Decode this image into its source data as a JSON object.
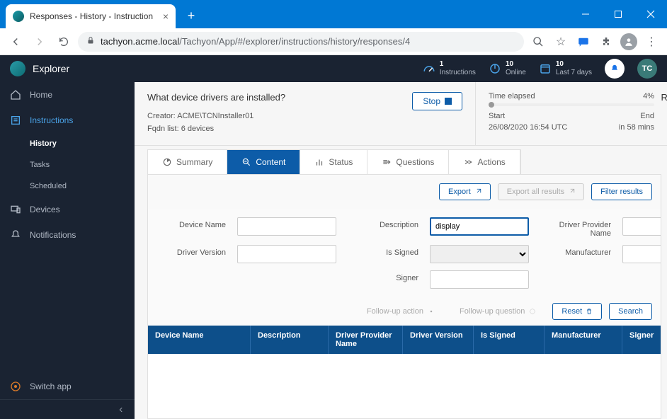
{
  "browser": {
    "tab_title": "Responses - History - Instruction",
    "url_host": "tachyon.acme.local",
    "url_path": "/Tachyon/App/#/explorer/instructions/history/responses/4"
  },
  "app_header": {
    "title": "Explorer",
    "status": [
      {
        "num": "1",
        "lbl": "Instructions"
      },
      {
        "num": "10",
        "lbl": "Online"
      },
      {
        "num": "10",
        "lbl": "Last 7 days"
      }
    ],
    "user_initials": "TC"
  },
  "sidebar": {
    "items": [
      {
        "label": "Home"
      },
      {
        "label": "Instructions",
        "active": true
      },
      {
        "label": "Devices"
      },
      {
        "label": "Notifications"
      }
    ],
    "subs": [
      {
        "label": "History",
        "active": true
      },
      {
        "label": "Tasks"
      },
      {
        "label": "Scheduled"
      }
    ],
    "switch": "Switch app"
  },
  "instruction": {
    "question": "What device drivers are installed?",
    "stop": "Stop",
    "creator_lbl": "Creator:",
    "creator": "ACME\\TCNInstaller01",
    "fqdn_lbl": "Fqdn list:",
    "fqdn": "6 devices",
    "elapsed_lbl": "Time elapsed",
    "elapsed_pct": "4%",
    "start_lbl": "Start",
    "end_lbl": "End",
    "start_val": "26/08/2020 16:54 UTC",
    "end_val": "in 58 mins",
    "responses_cut": "Response"
  },
  "tabs": [
    "Summary",
    "Content",
    "Status",
    "Questions",
    "Actions"
  ],
  "active_tab": "Content",
  "buttons": {
    "export": "Export",
    "export_all": "Export all results",
    "filter": "Filter results",
    "followup_action": "Follow-up action",
    "followup_question": "Follow-up question",
    "reset": "Reset",
    "search": "Search"
  },
  "filters": {
    "device_name": {
      "label": "Device Name",
      "value": ""
    },
    "description": {
      "label": "Description",
      "value": "display"
    },
    "driver_provider": {
      "label": "Driver Provider Name",
      "value": ""
    },
    "driver_version": {
      "label": "Driver Version",
      "value": ""
    },
    "is_signed": {
      "label": "Is Signed",
      "value": ""
    },
    "manufacturer": {
      "label": "Manufacturer",
      "value": ""
    },
    "signer": {
      "label": "Signer",
      "value": ""
    }
  },
  "table": {
    "columns": [
      "Device Name",
      "Description",
      "Driver Provider Name",
      "Driver Version",
      "Is Signed",
      "Manufacturer",
      "Signer"
    ]
  }
}
